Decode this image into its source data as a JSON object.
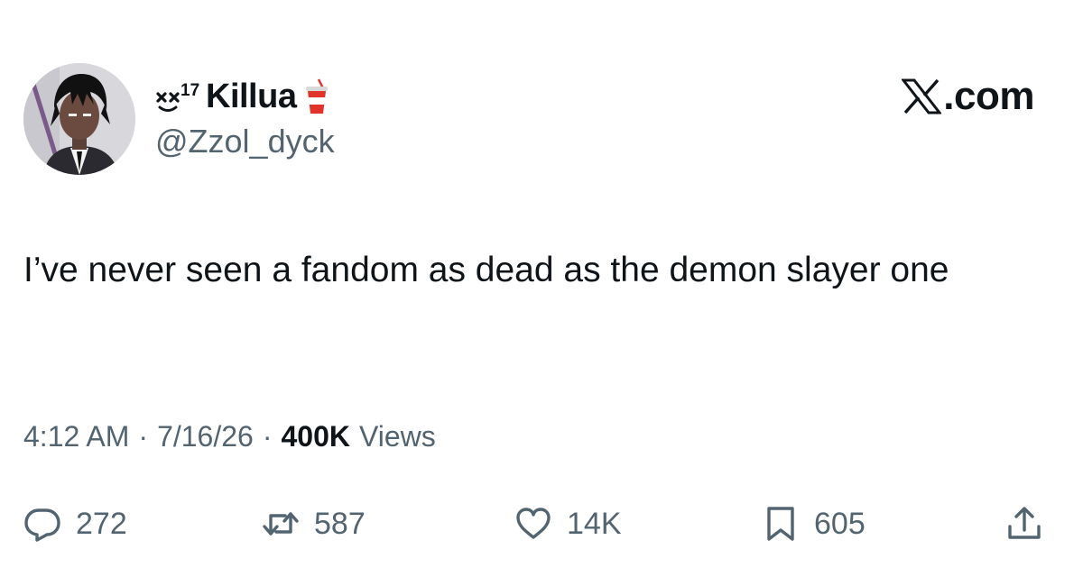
{
  "author": {
    "display_name": "Killua",
    "name_prefix": "xx17",
    "name_suffix_icon": "drink-cup-icon",
    "handle": "@Zzol_dyck",
    "avatar_icon": "anime-character-avatar"
  },
  "brand": {
    "logo_icon": "x-logo-icon",
    "domain": ".com"
  },
  "tweet": {
    "text": "I’ve never seen a fandom as dead as the demon slayer one"
  },
  "meta": {
    "time": "4:12 AM",
    "sep1": "·",
    "date": "7/16/26",
    "sep2": "·",
    "views_count": "400K",
    "views_label": "Views"
  },
  "actions": {
    "replies": "272",
    "reposts": "587",
    "likes": "14K",
    "bookmarks": "605"
  },
  "colors": {
    "text": "#0f1419",
    "secondary": "#536471",
    "background": "#ffffff"
  }
}
